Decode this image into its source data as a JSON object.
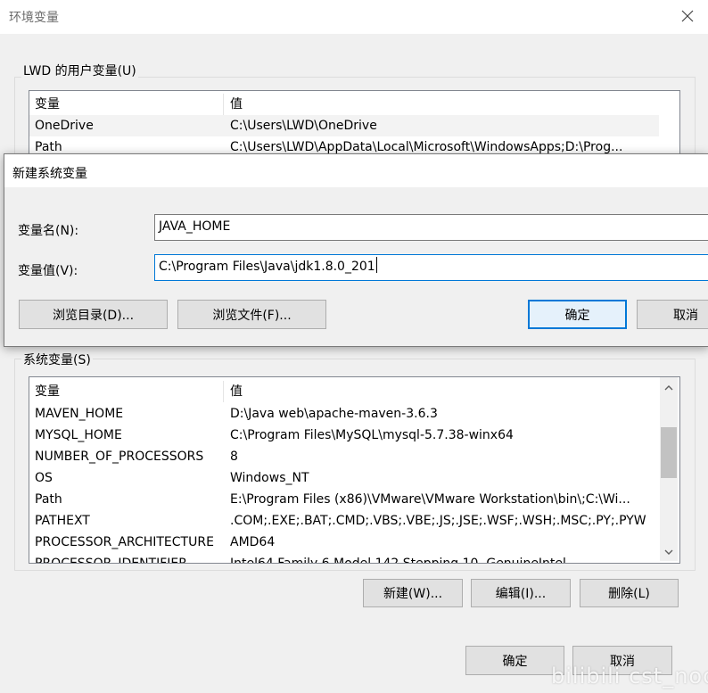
{
  "window": {
    "title": "环境变量",
    "close_icon": "close-icon"
  },
  "user_vars": {
    "group_label": "LWD 的用户变量(U)",
    "columns": [
      "变量",
      "值"
    ],
    "rows": [
      {
        "name": "OneDrive",
        "value": "C:\\Users\\LWD\\OneDrive"
      },
      {
        "name": "Path",
        "value": "C:\\Users\\LWD\\AppData\\Local\\Microsoft\\WindowsApps;D:\\Prog..."
      }
    ]
  },
  "dialog": {
    "title": "新建系统变量",
    "name_label": "变量名(N):",
    "name_value": "JAVA_HOME",
    "value_label": "变量值(V):",
    "value_value": "C:\\Program Files\\Java\\jdk1.8.0_201",
    "browse_dir_label": "浏览目录(D)...",
    "browse_file_label": "浏览文件(F)...",
    "ok_label": "确定",
    "cancel_label": "取消"
  },
  "system_vars": {
    "group_label": "系统变量(S)",
    "columns": [
      "变量",
      "值"
    ],
    "rows": [
      {
        "name": "MAVEN_HOME",
        "value": "D:\\Java web\\apache-maven-3.6.3"
      },
      {
        "name": "MYSQL_HOME",
        "value": "C:\\Program Files\\MySQL\\mysql-5.7.38-winx64"
      },
      {
        "name": "NUMBER_OF_PROCESSORS",
        "value": "8"
      },
      {
        "name": "OS",
        "value": "Windows_NT"
      },
      {
        "name": "Path",
        "value": "E:\\Program Files (x86)\\VMware\\VMware Workstation\\bin\\;C:\\Wi..."
      },
      {
        "name": "PATHEXT",
        "value": ".COM;.EXE;.BAT;.CMD;.VBS;.VBE;.JS;.JSE;.WSF;.WSH;.MSC;.PY;.PYW"
      },
      {
        "name": "PROCESSOR_ARCHITECTURE",
        "value": "AMD64"
      },
      {
        "name": "PROCESSOR_IDENTIFIER",
        "value": "Intel64 Family 6 Model 142 Stepping 10, GenuineIntel"
      }
    ],
    "new_label": "新建(W)...",
    "edit_label": "编辑(I)...",
    "delete_label": "删除(L)"
  },
  "footer": {
    "ok_label": "确定",
    "cancel_label": "取消"
  },
  "watermark": {
    "text": "bilibili  cst_noob"
  },
  "colors": {
    "accent": "#0078d7",
    "dialog_bg": "#f0f0f0"
  }
}
